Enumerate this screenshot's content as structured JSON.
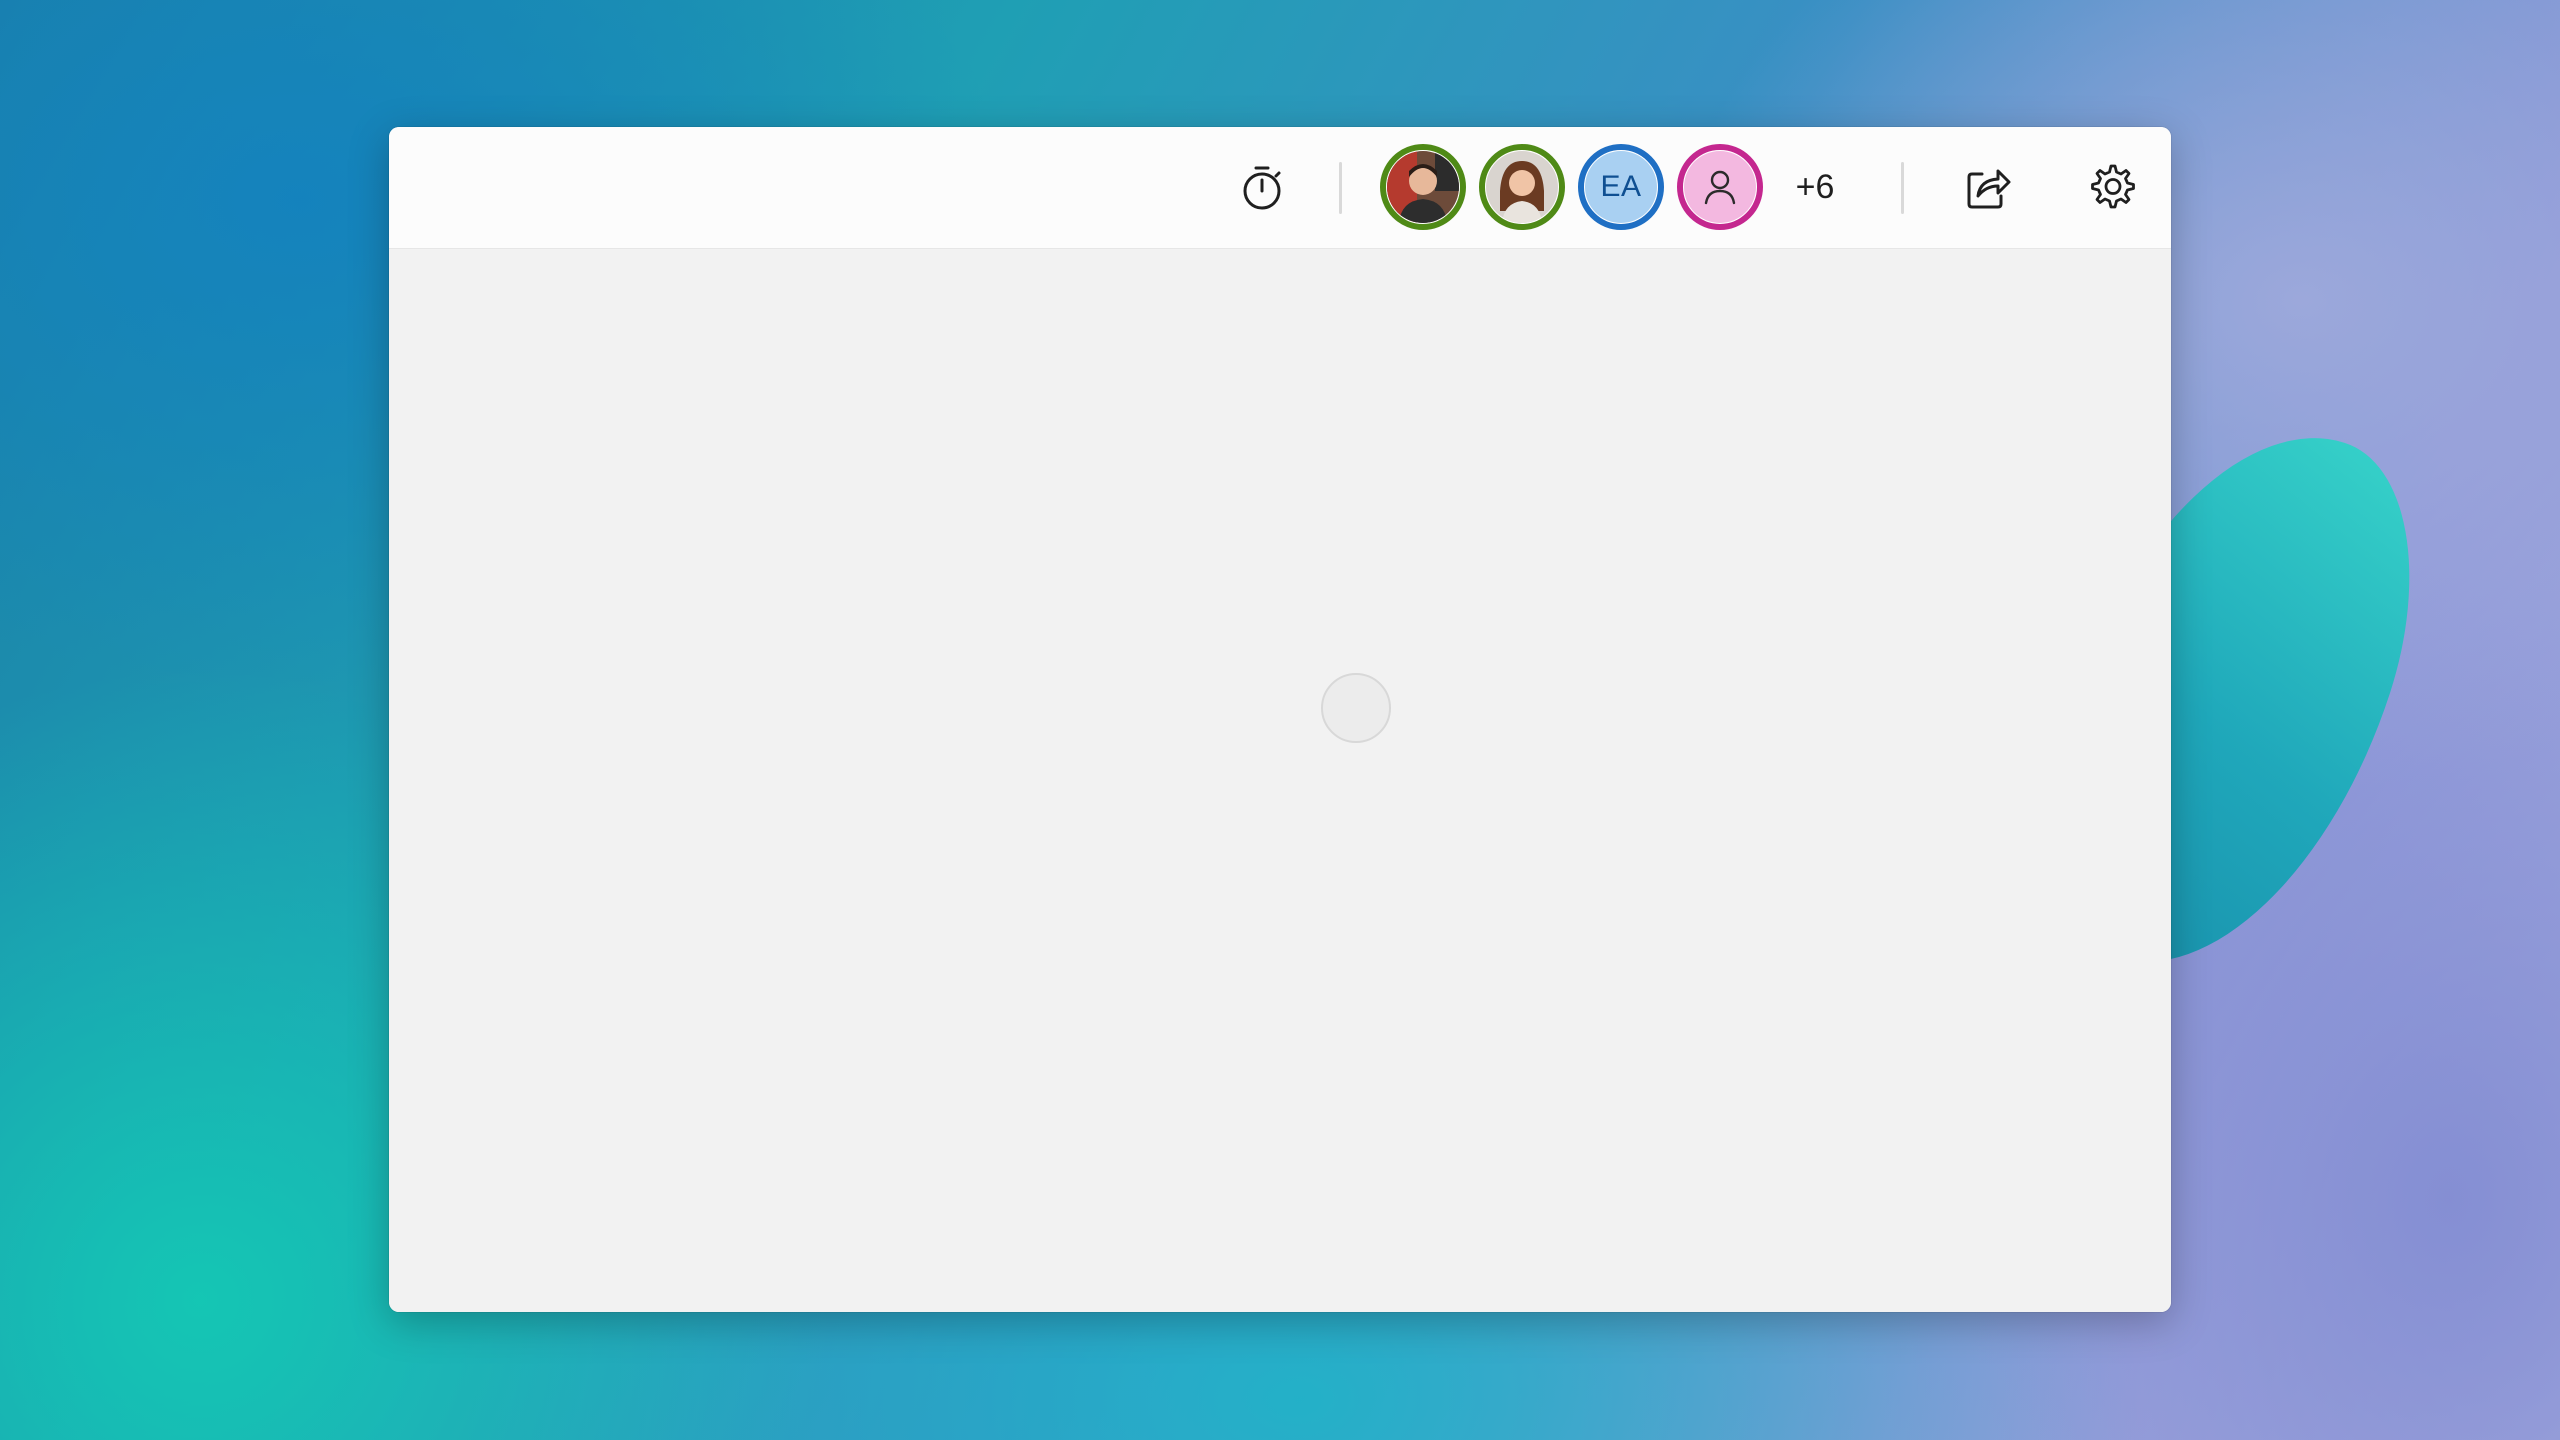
{
  "toolbar": {
    "timer_icon": "stopwatch-icon",
    "participants": [
      {
        "type": "photo",
        "ring_color": "#4f8a16",
        "icon": "person-photo-male"
      },
      {
        "type": "photo",
        "ring_color": "#4f8a16",
        "icon": "person-photo-female"
      },
      {
        "type": "initials",
        "initials": "EA",
        "ring_color": "#1f6fc4",
        "fill_color": "#a9d0f2"
      },
      {
        "type": "placeholder",
        "ring_color": "#c4278f",
        "fill_color": "#f3b8e0",
        "icon": "person-outline-icon"
      }
    ],
    "more_count": "+6",
    "share_icon": "share-icon",
    "settings_icon": "gear-icon"
  }
}
